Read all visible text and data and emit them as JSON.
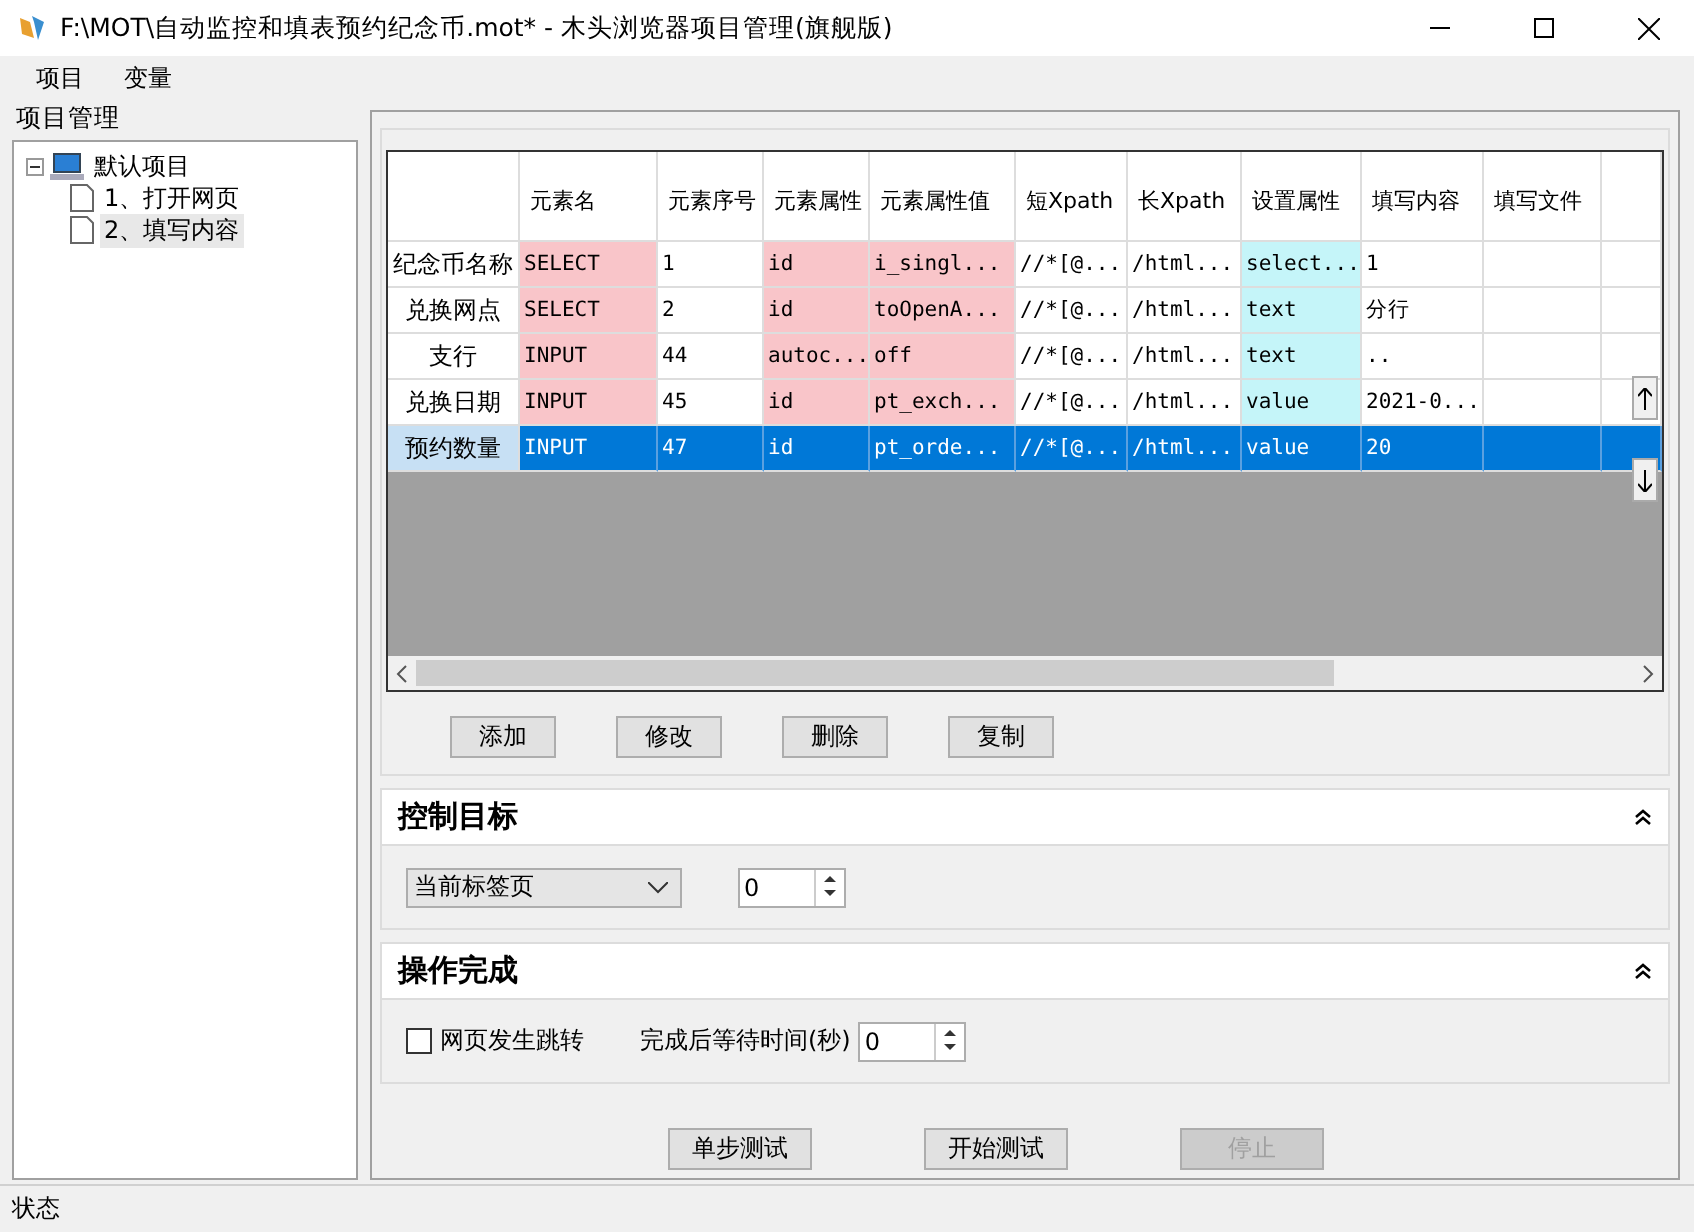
{
  "window": {
    "title": "F:\\MOT\\自动监控和填表预约纪念币.mot* - 木头浏览器项目管理(旗舰版)"
  },
  "menu": [
    "项目",
    "变量"
  ],
  "project_panel": {
    "title": "项目管理",
    "tree": [
      {
        "label": "默认项目",
        "expanded": true,
        "children": [
          {
            "label": "1、打开网页",
            "selected": false
          },
          {
            "label": "2、填写内容",
            "selected": true
          }
        ]
      }
    ]
  },
  "table": {
    "columns": [
      {
        "label": "元素名",
        "color": "#f9c5c9"
      },
      {
        "label": "元素序号"
      },
      {
        "label": "元素属性",
        "color": "#f9c5c9"
      },
      {
        "label": "元素属性值",
        "color": "#f9c5c9"
      },
      {
        "label": "短Xpath"
      },
      {
        "label": "长Xpath"
      },
      {
        "label": "设置属性",
        "color": "#c5f5f9"
      },
      {
        "label": "填写内容"
      },
      {
        "label": "填写文件"
      }
    ],
    "rows": [
      {
        "header": "纪念币名称",
        "selected": false,
        "cells": [
          "SELECT",
          "1",
          "id",
          "i_singl...",
          "//*[@...",
          "/html...",
          "select...",
          "1",
          ""
        ]
      },
      {
        "header": "兑换网点",
        "selected": false,
        "cells": [
          "SELECT",
          "2",
          "id",
          "toOpenA...",
          "//*[@...",
          "/html...",
          "text",
          "分行",
          ""
        ]
      },
      {
        "header": "支行",
        "selected": false,
        "cells": [
          "INPUT",
          "44",
          "autoc...",
          "off",
          "//*[@...",
          "/html...",
          "text",
          "..",
          ""
        ]
      },
      {
        "header": "兑换日期",
        "selected": false,
        "cells": [
          "INPUT",
          "45",
          "id",
          "pt_exch...",
          "//*[@...",
          "/html...",
          "value",
          "2021-0...",
          ""
        ]
      },
      {
        "header": "预约数量",
        "selected": true,
        "cells": [
          "INPUT",
          "47",
          "id",
          "pt_orde...",
          "//*[@...",
          "/html...",
          "value",
          "20",
          ""
        ]
      }
    ]
  },
  "table_buttons": [
    "添加",
    "修改",
    "删除",
    "复制"
  ],
  "control_target": {
    "title": "控制目标",
    "dropdown": "当前标签页",
    "spinner": "0"
  },
  "on_complete": {
    "title": "操作完成",
    "checkbox": {
      "label": "网页发生跳转",
      "checked": false
    },
    "wait_label": "完成后等待时间(秒)",
    "spinner": "0"
  },
  "actions": [
    {
      "label": "单步测试",
      "disabled": false
    },
    {
      "label": "开始测试",
      "disabled": false
    },
    {
      "label": "停止",
      "disabled": true
    }
  ],
  "status_bar": "状态"
}
